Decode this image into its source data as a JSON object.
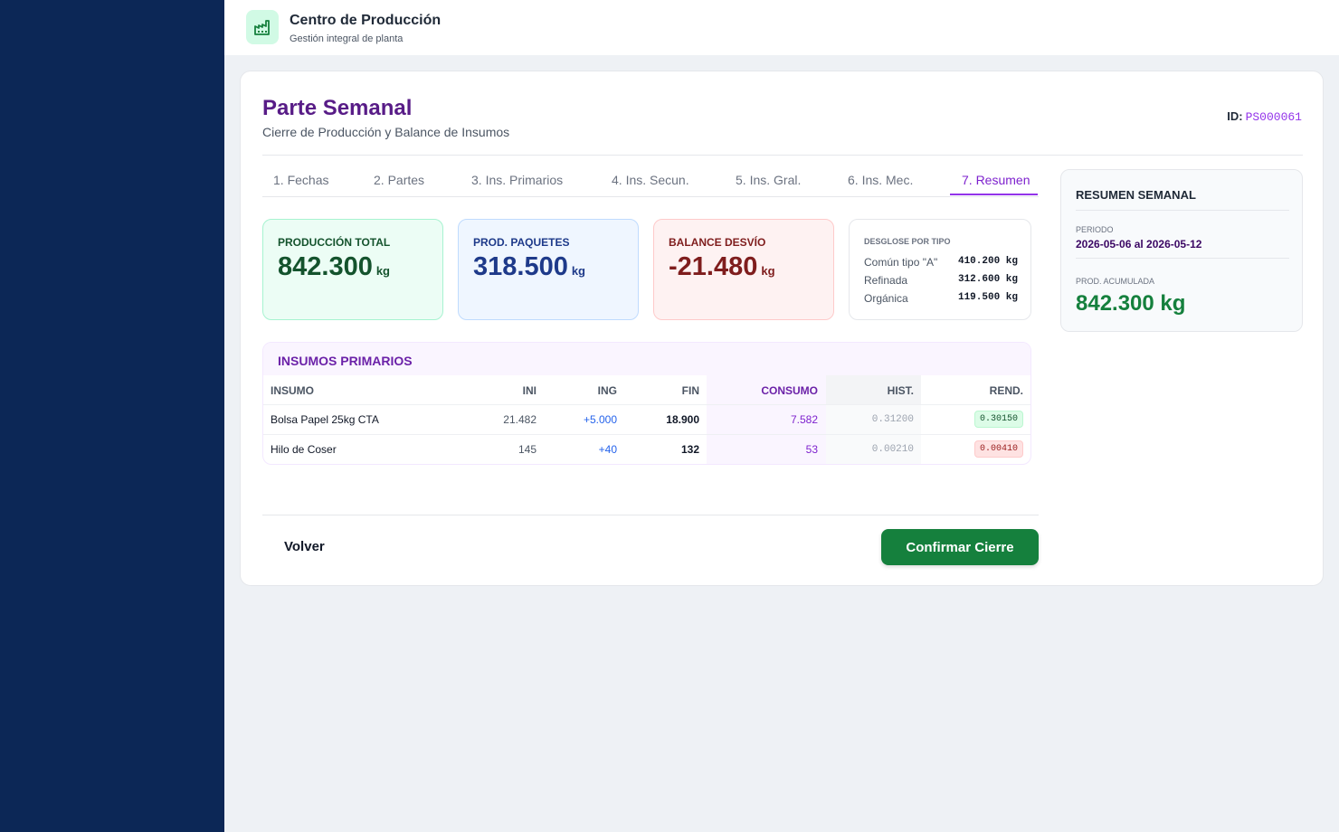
{
  "app": {
    "title": "Centro de Producción",
    "subtitle": "Gestión integral de planta"
  },
  "page": {
    "title": "Parte Semanal",
    "subtitle": "Cierre de Producción y Balance de Insumos",
    "id_label": "ID:",
    "id_value": "PS000061"
  },
  "tabs": [
    {
      "label": "1. Fechas",
      "active": false
    },
    {
      "label": "2. Partes",
      "active": false
    },
    {
      "label": "3. Ins. Primarios",
      "active": false
    },
    {
      "label": "4. Ins. Secun.",
      "active": false
    },
    {
      "label": "5. Ins. Gral.",
      "active": false
    },
    {
      "label": "6. Ins. Mec.",
      "active": false
    },
    {
      "label": "7. Resumen",
      "active": true
    }
  ],
  "stats": {
    "total": {
      "label": "PRODUCCIÓN TOTAL",
      "value": "842.300",
      "unit": "kg"
    },
    "packages": {
      "label": "PROD. PAQUETES",
      "value": "318.500",
      "unit": "kg"
    },
    "balance": {
      "label": "BALANCE DESVÍO",
      "value": "-21.480",
      "unit": "kg"
    }
  },
  "breakdown": {
    "title": "DESGLOSE POR TIPO",
    "rows": [
      {
        "name": "Común tipo \"A\"",
        "value": "410.200 kg"
      },
      {
        "name": "Refinada",
        "value": "312.600 kg"
      },
      {
        "name": "Orgánica",
        "value": "119.500 kg"
      }
    ]
  },
  "inputs_table": {
    "title": "INSUMOS PRIMARIOS",
    "headers": {
      "insumo": "INSUMO",
      "ini": "INI",
      "ing": "ING",
      "fin": "FIN",
      "consumo": "CONSUMO",
      "hist": "HIST.",
      "rend": "REND."
    },
    "rows": [
      {
        "insumo": "Bolsa Papel 25kg CTA",
        "ini": "21.482",
        "ing": "+5.000",
        "fin": "18.900",
        "consumo": "7.582",
        "hist": "0.31200",
        "rend": "0.30150",
        "rend_status": "good"
      },
      {
        "insumo": "Hilo de Coser",
        "ini": "145",
        "ing": "+40",
        "fin": "132",
        "consumo": "53",
        "hist": "0.00210",
        "rend": "0.00410",
        "rend_status": "bad"
      }
    ]
  },
  "actions": {
    "back": "Volver",
    "confirm": "Confirmar Cierre"
  },
  "summary": {
    "title": "RESUMEN SEMANAL",
    "period_label": "PERIODO",
    "period_value": "2026-05-06 al 2026-05-12",
    "accumulated_label": "PROD. ACUMULADA",
    "accumulated_value": "842.300 kg"
  },
  "colors": {
    "sidebar": "#0c2756",
    "accent_purple": "#581c87",
    "confirm_green": "#15803d"
  },
  "icons": {
    "app_logo": "factory-icon"
  }
}
